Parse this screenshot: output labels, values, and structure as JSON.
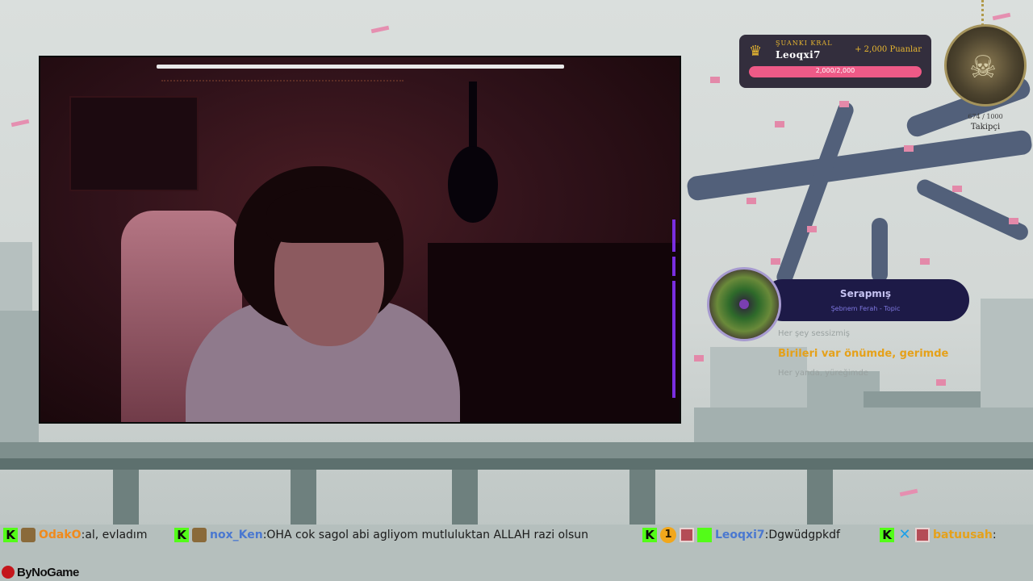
{
  "king": {
    "label": "ŞUANKI KRAL",
    "username": "Leoqxi7",
    "points": "+ 2,000 Puanlar",
    "progress_text": "2,000/2,000",
    "progress_fraction": 1.0
  },
  "followers": {
    "count": "674 / 1000",
    "label": "Takipçi"
  },
  "music": {
    "title": "Serapmış",
    "artist": "Şebnem Ferah - Topic",
    "lyric_prev": "Her şey sessizmiş",
    "lyric_current": "Birileri var önümde, gerimde",
    "lyric_next": "Her yanda, yüreğimde"
  },
  "chat": [
    {
      "username": "OdakO",
      "separator": ":",
      "text": "al, evladım",
      "color": "#f08a1c"
    },
    {
      "username": "nox_Ken",
      "separator": ":",
      "text": "OHA cok sagol abi agliyom mutluluktan ALLAH razi olsun",
      "color": "#4a78d0"
    },
    {
      "username": "Leoqxi7",
      "separator": ":",
      "text": "Dgwüdgpkdf",
      "color": "#4a78d0"
    },
    {
      "username": "batuusah",
      "separator": ":",
      "text": "",
      "color": "#e5a11a"
    }
  ],
  "badges": {
    "one": "1"
  },
  "brand": {
    "name": "ByNoGame"
  },
  "colors": {
    "accent": "#53fc18",
    "king_bar": "#ee5a87",
    "music_bg": "#1d1a47"
  }
}
